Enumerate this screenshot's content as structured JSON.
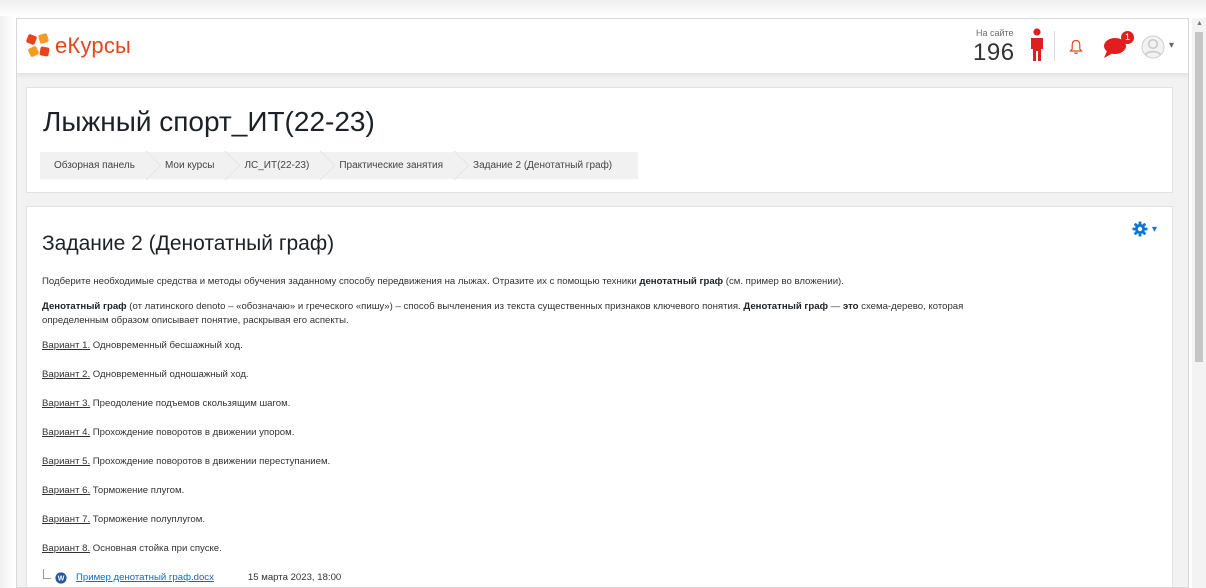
{
  "navbar": {
    "brand": "eКурсы",
    "online_label": "На сайте",
    "online_count": "196",
    "notifications_badge": "1"
  },
  "header": {
    "course_title": "Лыжный спорт_ИТ(22-23)",
    "breadcrumb": [
      "Обзорная панель",
      "Мои курсы",
      "ЛС_ИТ(22-23)",
      "Практические занятия",
      "Задание 2 (Денотатный граф)"
    ]
  },
  "assignment": {
    "title": "Задание 2 (Денотатный граф)",
    "intro_before": "Подберите необходимые средства и методы обучения заданному способу передвижения на лыжах. Отразите их с помощью техники ",
    "intro_bold": "денотатный граф",
    "intro_after": " (см. пример во вложении).",
    "def_bold1": "Денотатный граф",
    "def_text1": " (от латинского denoto – «обозначаю» и греческого «пишу») – способ вычленения из текста существенных признаков ключевого понятия. ",
    "def_bold2": "Денотатный граф",
    "def_text2": " — ",
    "def_bold3": "это",
    "def_text3": " схема-дерево, которая",
    "def_line2": "определенным образом описывает понятие, раскрывая его аспекты.",
    "variants": [
      {
        "label": "Вариант 1.",
        "text": " Одновременный бесшажный ход."
      },
      {
        "label": "Вариант 2.",
        "text": " Одновременный одношажный ход."
      },
      {
        "label": "Вариант 3.",
        "text": " Преодоление подъемов скользящим шагом."
      },
      {
        "label": "Вариант 4.",
        "text": " Прохождение поворотов в движении упором."
      },
      {
        "label": "Вариант 5.",
        "text": " Прохождение поворотов в движении переступанием."
      },
      {
        "label": "Вариант 6.",
        "text": " Торможение плугом."
      },
      {
        "label": "Вариант 7.",
        "text": " Торможение полуплугом."
      },
      {
        "label": "Вариант 8.",
        "text": " Основная стойка при спуске."
      }
    ],
    "attachment": {
      "filename": "Пример денотатный граф.docx",
      "date": "15 марта 2023, 18:00"
    }
  },
  "colors": {
    "brand": "#e8431f",
    "accent": "#0f6cbf",
    "badge": "#e01e1e"
  },
  "icons": [
    "brand-logo-icon",
    "person-icon",
    "bell-icon",
    "chat-icon",
    "avatar-icon",
    "gear-icon",
    "file-icon"
  ]
}
